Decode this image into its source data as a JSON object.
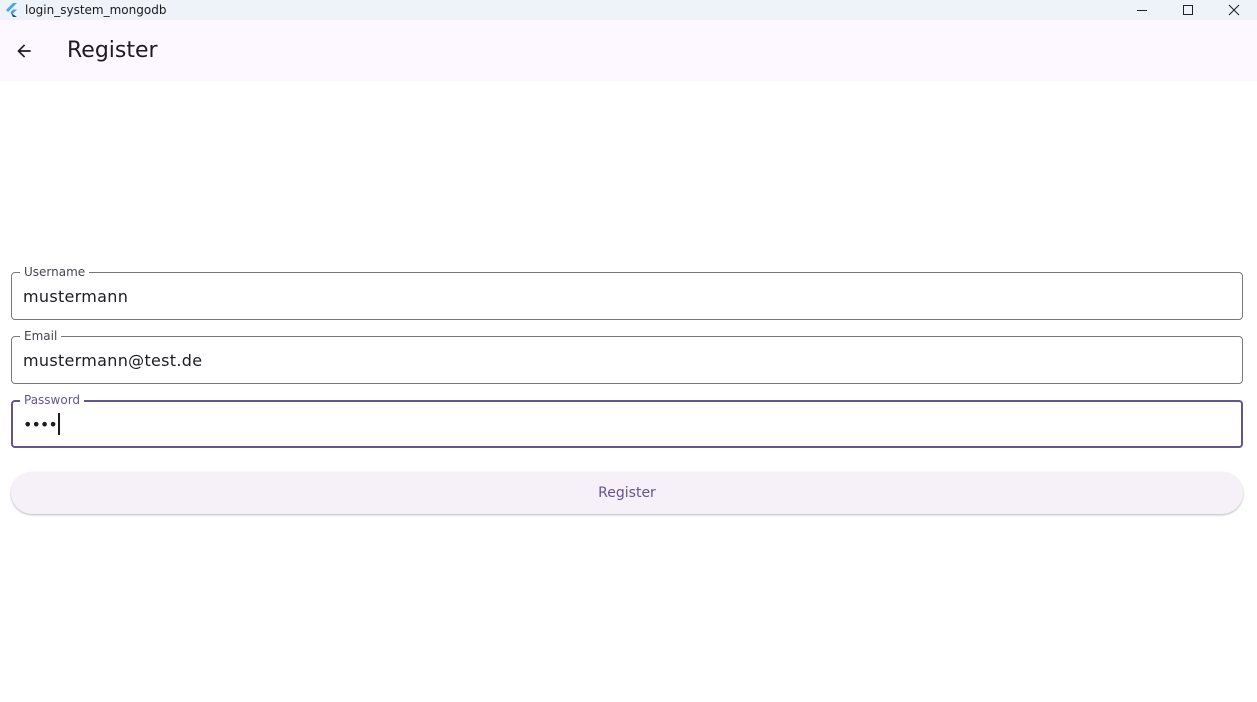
{
  "window": {
    "title": "login_system_mongodb",
    "icon": "flutter-logo-icon",
    "controls": [
      "minimize-icon",
      "maximize-icon",
      "close-icon"
    ]
  },
  "appbar": {
    "back_icon": "arrow-back-icon",
    "title": "Register"
  },
  "form": {
    "username": {
      "label": "Username",
      "value": "mustermann"
    },
    "email": {
      "label": "Email",
      "value": "mustermann@test.de"
    },
    "password": {
      "label": "Password",
      "masked_value": "••••",
      "focused": true
    },
    "submit_label": "Register"
  },
  "colors": {
    "appbar_bg": "#fdf7ff",
    "accent": "#65558f",
    "outline": "#79747e",
    "button_bg": "#f6f1f8"
  }
}
